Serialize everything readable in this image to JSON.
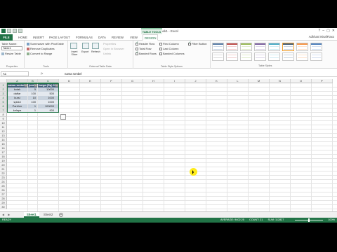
{
  "window": {
    "title": "Book1 - Excel",
    "tools_tab": "TABLE TOOLS",
    "user": "Adhhani NisafFiaxo",
    "controls": [
      "?",
      "–",
      "▢",
      "✕"
    ]
  },
  "tabs": [
    "FILE",
    "HOME",
    "INSERT",
    "PAGE LAYOUT",
    "FORMULAS",
    "DATA",
    "REVIEW",
    "VIEW",
    "DESIGN"
  ],
  "ribbon": {
    "properties": {
      "table_name_label": "Table Name:",
      "table_name_value": "Table1",
      "resize": "Resize Table",
      "group": "Properties"
    },
    "tools": {
      "items": [
        "Summarize with PivotTable",
        "Remove Duplicates",
        "Convert to Range"
      ],
      "group": "Tools"
    },
    "external": {
      "insert_slicer": "Insert Slicer",
      "export": "Export",
      "refresh": "Refresh",
      "items": [
        "Properties",
        "Open in Browser",
        "Unlink"
      ],
      "group": "External Table Data"
    },
    "style_options": {
      "options": [
        {
          "label": "Header Row",
          "checked": true
        },
        {
          "label": "Total Row",
          "checked": false
        },
        {
          "label": "Banded Rows",
          "checked": true
        },
        {
          "label": "First Column",
          "checked": false
        },
        {
          "label": "Last Column",
          "checked": false
        },
        {
          "label": "Banded Columns",
          "checked": false
        },
        {
          "label": "Filter Button",
          "checked": true
        }
      ],
      "group": "Table Style Options"
    },
    "styles_group": "Table Styles"
  },
  "formula_bar": {
    "name_box": "A1",
    "fx": "fx",
    "value": "nama rombel"
  },
  "grid": {
    "columns": [
      "A",
      "B",
      "C",
      "D",
      "E",
      "F",
      "G",
      "H",
      "I",
      "J",
      "K",
      "L",
      "M",
      "N",
      "O",
      "P"
    ],
    "rows": [
      "1",
      "2",
      "3",
      "4",
      "5",
      "6",
      "7",
      "8",
      "9",
      "10",
      "11",
      "12",
      "13",
      "14",
      "15",
      "16",
      "17",
      "18",
      "19",
      "20",
      "21",
      "22",
      "23",
      "24",
      "25",
      "26",
      "27",
      "28",
      "29",
      "30"
    ],
    "table": {
      "headers": [
        "nama rombel",
        "jumlah",
        "harga (Rp) 3hari"
      ],
      "rows": [
        [
          "kotak",
          "5",
          "10000"
        ],
        [
          "daftar",
          "100",
          "500"
        ],
        [
          "kursi",
          "10",
          "1000"
        ],
        [
          "spidol",
          "100",
          "1000"
        ],
        [
          "Panther",
          "1",
          "100000"
        ],
        [
          "kelapa",
          "1",
          "900"
        ]
      ]
    }
  },
  "sheets": [
    "Sheet1",
    "Sheet2"
  ],
  "status": {
    "mode": "READY",
    "average": "AVERAGE: 9402.25",
    "count": "COUNT: 21",
    "sum": "SUM: 112827",
    "zoom": "100%"
  }
}
